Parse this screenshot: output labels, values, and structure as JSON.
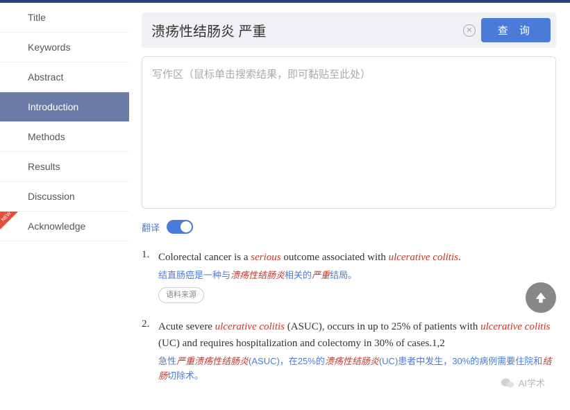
{
  "sidebar": {
    "items": [
      {
        "label": "Title"
      },
      {
        "label": "Keywords"
      },
      {
        "label": "Abstract"
      },
      {
        "label": "Introduction"
      },
      {
        "label": "Methods"
      },
      {
        "label": "Results"
      },
      {
        "label": "Discussion"
      },
      {
        "label": "Acknowledge"
      }
    ],
    "new_badge": "NEW"
  },
  "search": {
    "value": "溃疡性结肠炎 严重",
    "query_button": "查 询"
  },
  "write_area": {
    "placeholder": "写作区（鼠标单击搜索结果，即可黏贴至此处）"
  },
  "translate": {
    "label": "翻译",
    "on": true
  },
  "results": [
    {
      "num": "1.",
      "en_pre": "Colorectal cancer is a ",
      "en_hl1": "serious",
      "en_mid": " outcome associated with ",
      "en_hl2": "ulcerative colitis",
      "en_post": ".",
      "cn_pre": "结直肠癌是一种与",
      "cn_hl1": "溃疡性结肠炎",
      "cn_mid": "相关的",
      "cn_hl2": "严重",
      "cn_post": "结局。",
      "source_label": "语料来源"
    },
    {
      "num": "2.",
      "en_pre": "Acute severe ",
      "en_hl1": "ulcerative colitis",
      "en_mid": " (ASUC), occurs in up to 25% of patients with ",
      "en_hl2": "ulcerative colitis",
      "en_post": " (UC) and requires hospitalization and colectomy in 30% of cases.1,2",
      "cn_pre": "急性",
      "cn_hl1": "严重溃疡性结肠炎",
      "cn_mid": "(ASUC)，在25%的",
      "cn_hl2": "溃疡性结肠炎",
      "cn_mid2": "(UC)患者中发生，30%的病例需要住院和",
      "cn_hl3": "结肠",
      "cn_post": "切除术。"
    }
  ],
  "watermark": {
    "text": "AI学术"
  }
}
